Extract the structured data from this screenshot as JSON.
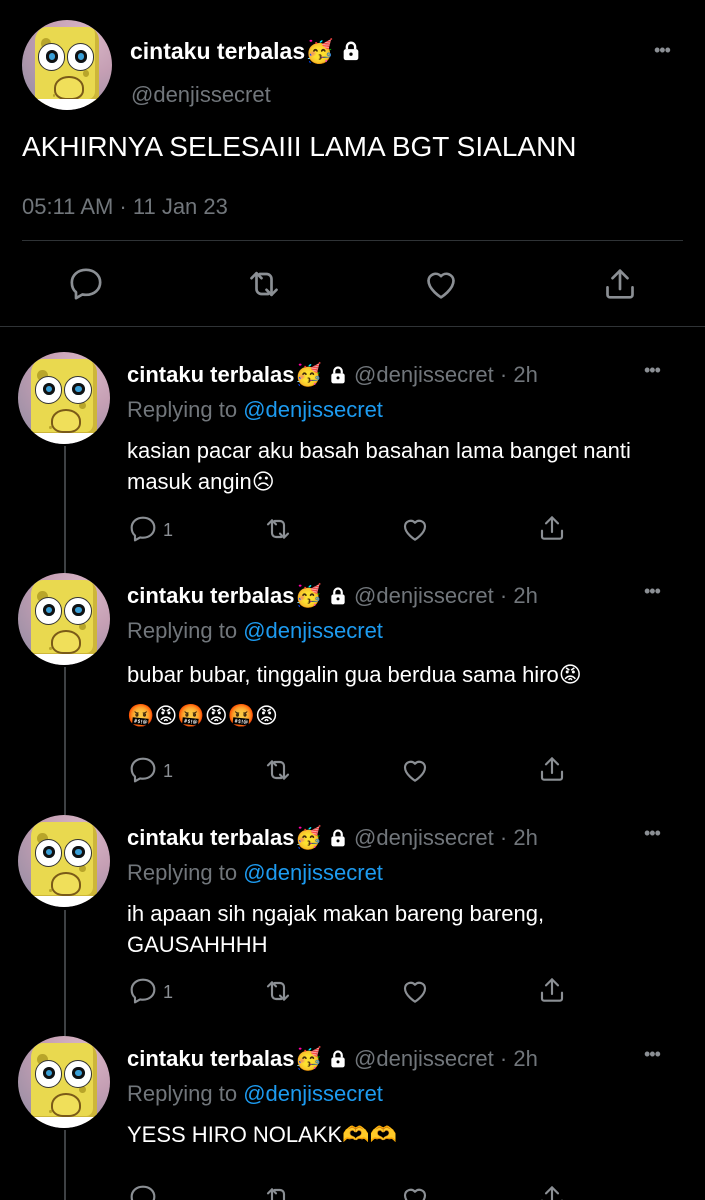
{
  "main": {
    "display_name": "cintaku terbalas",
    "name_emoji": "🥳",
    "handle": "@denjissecret",
    "text": "AKHIRNYA SELESAIII LAMA BGT SIALANN",
    "timestamp": "05:11 AM · 11 Jan 23",
    "more": "•••"
  },
  "replies": [
    {
      "display_name": "cintaku terbalas",
      "name_emoji": "🥳",
      "handle": "@denjissecret",
      "separator": " · ",
      "time": "2h",
      "replying_prefix": "Replying to ",
      "replying_to": "@denjissecret",
      "text": "kasian pacar aku basah basahan lama banget nanti masuk angin☹",
      "reply_count": "1",
      "more": "•••"
    },
    {
      "display_name": "cintaku terbalas",
      "name_emoji": "🥳",
      "handle": "@denjissecret",
      "separator": " · ",
      "time": "2h",
      "replying_prefix": "Replying to ",
      "replying_to": "@denjissecret",
      "text": "bubar bubar, tinggalin gua berdua sama hiro😡\n🤬😡🤬😡🤬😡",
      "reply_count": "1",
      "more": "•••"
    },
    {
      "display_name": "cintaku terbalas",
      "name_emoji": "🥳",
      "handle": "@denjissecret",
      "separator": " · ",
      "time": "2h",
      "replying_prefix": "Replying to ",
      "replying_to": "@denjissecret",
      "text": "ih apaan sih ngajak makan bareng bareng, GAUSAHHHH",
      "reply_count": "1",
      "more": "•••"
    },
    {
      "display_name": "cintaku terbalas",
      "name_emoji": "🥳",
      "handle": "@denjissecret",
      "separator": " · ",
      "time": "2h",
      "replying_prefix": "Replying to ",
      "replying_to": "@denjissecret",
      "text": "YESS HIRO NOLAKK🫶🫶",
      "more": "•••"
    }
  ],
  "icons": {
    "reply": "reply-icon",
    "retweet": "retweet-icon",
    "like": "like-icon",
    "share": "share-icon",
    "lock": "lock-icon",
    "more": "more-icon"
  },
  "colors": {
    "background": "#000000",
    "text": "#ffffff",
    "muted": "#71767b",
    "link": "#1d9bf0",
    "divider": "#2f3336"
  }
}
